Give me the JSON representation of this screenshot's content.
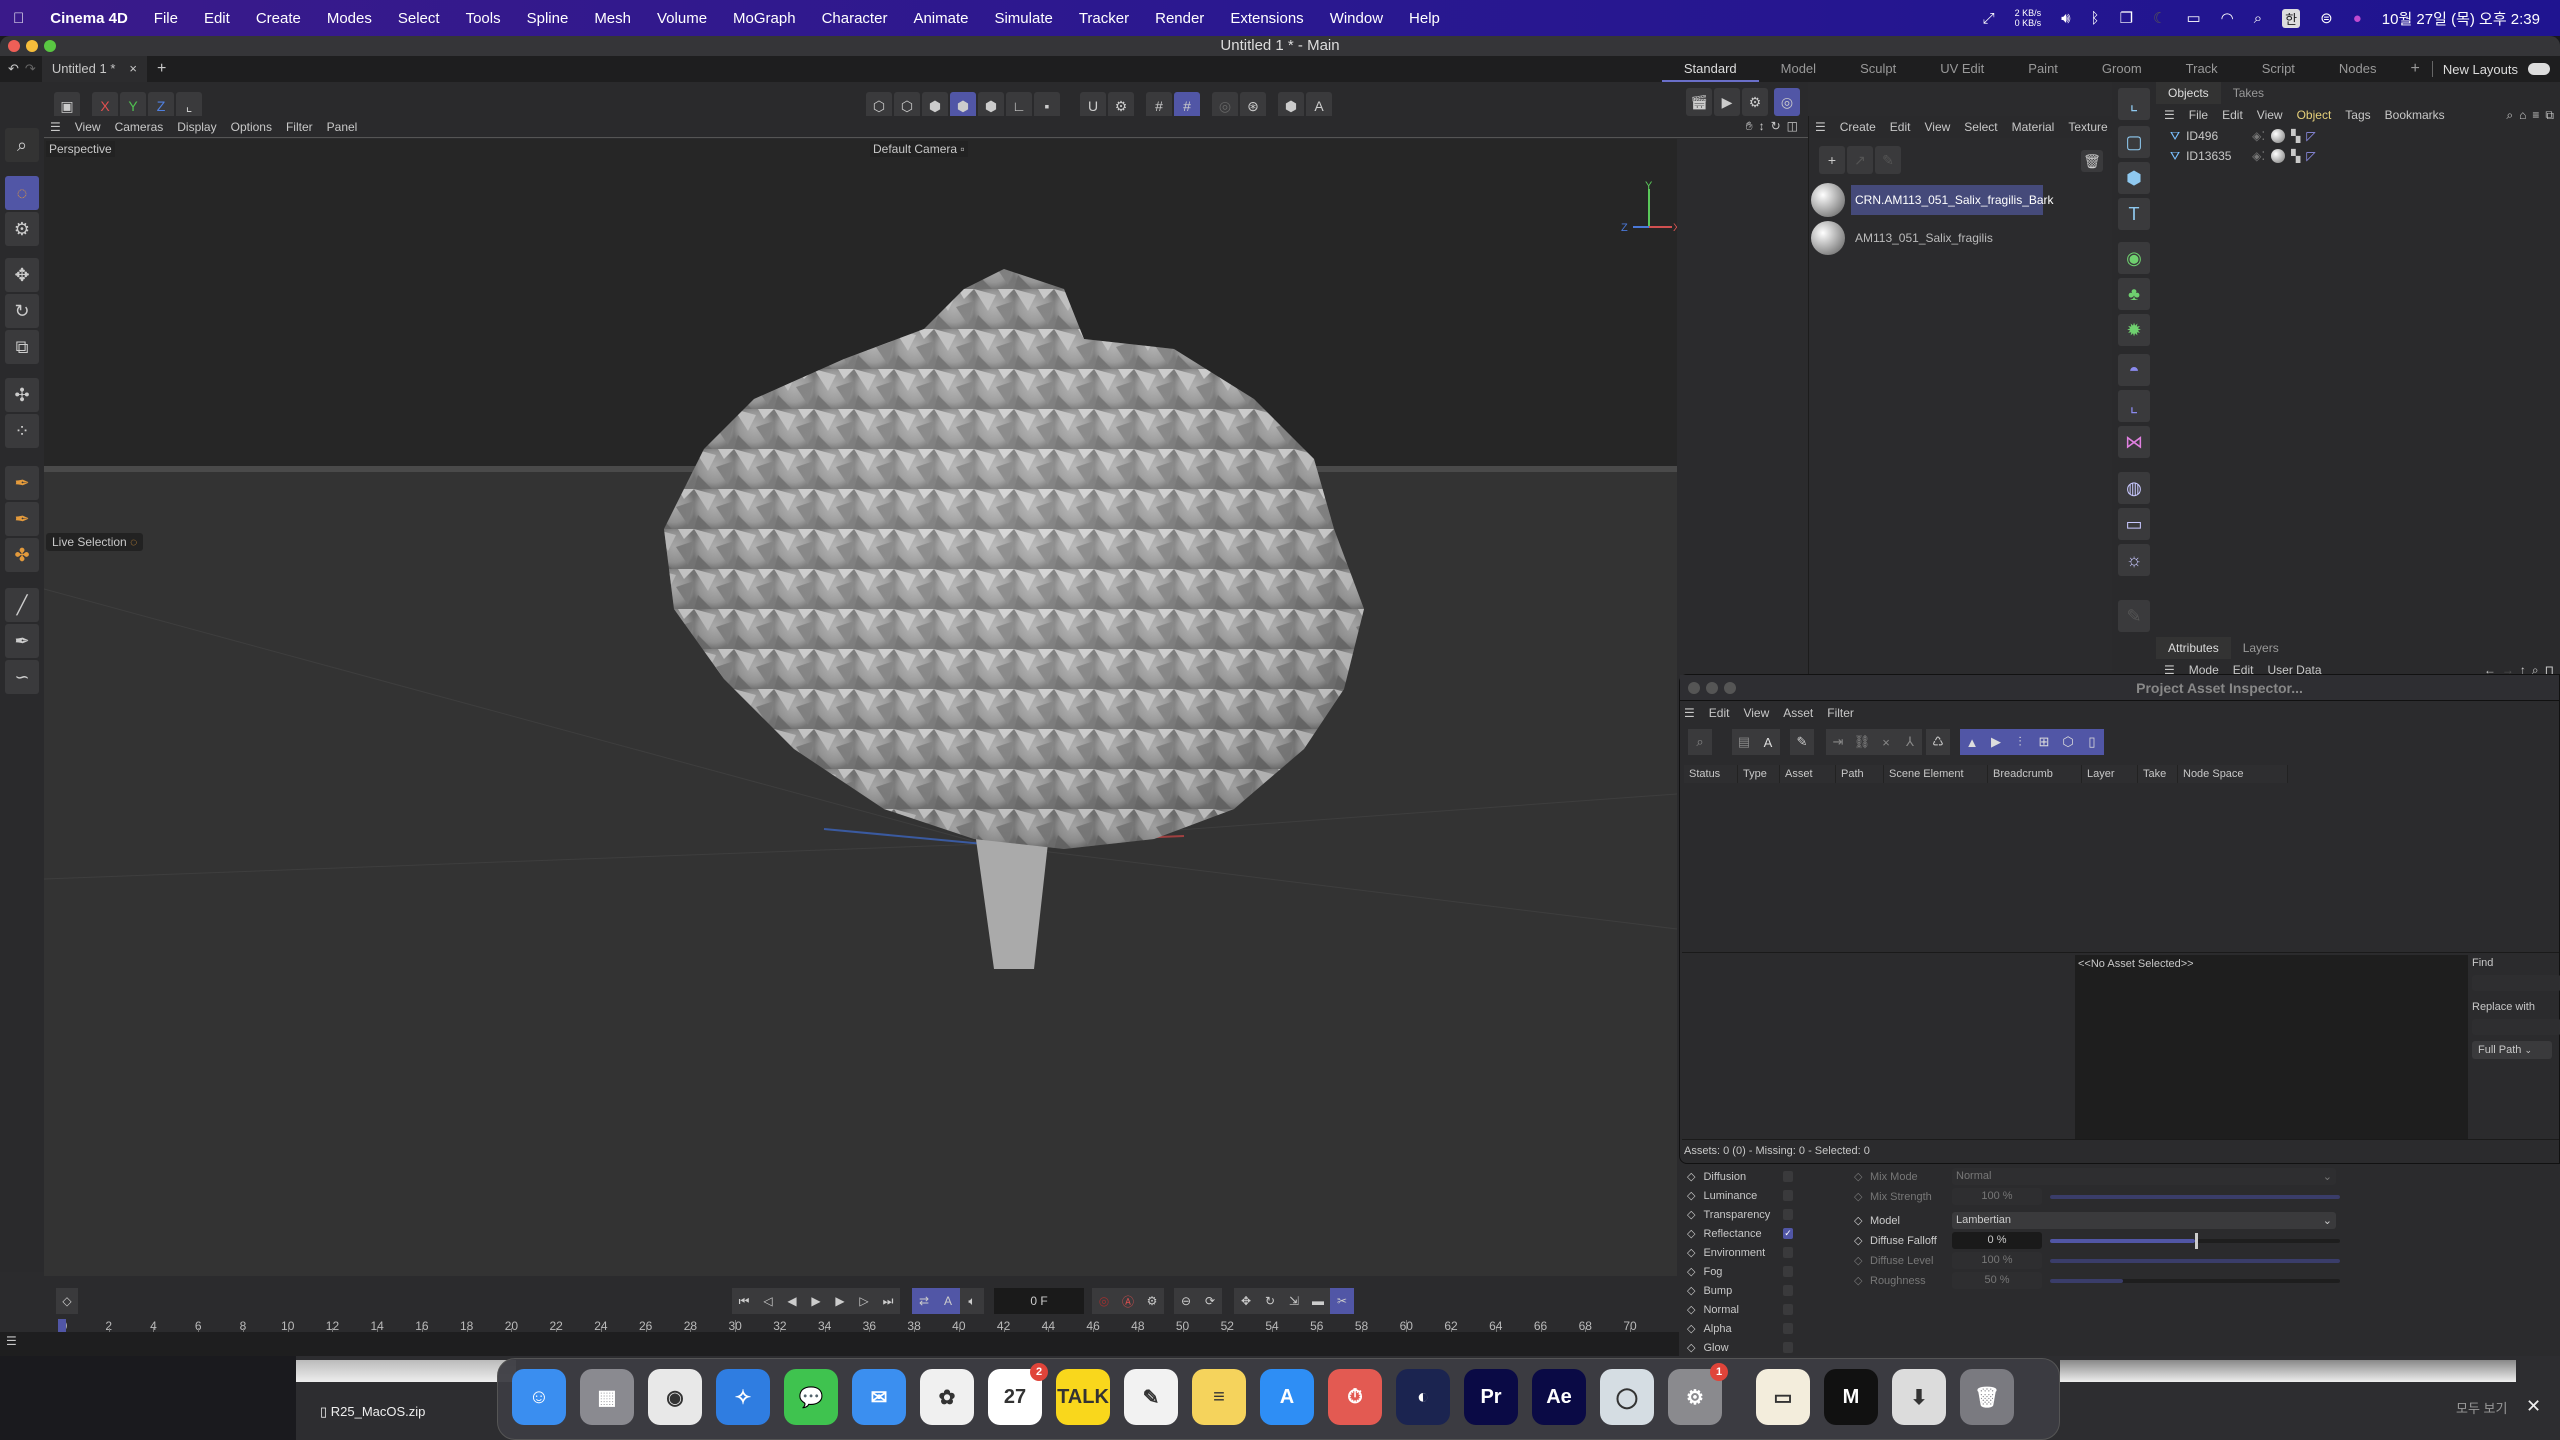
{
  "menubar": {
    "app": "Cinema 4D",
    "items": [
      "File",
      "Edit",
      "Create",
      "Modes",
      "Select",
      "Tools",
      "Spline",
      "Mesh",
      "Volume",
      "MoGraph",
      "Character",
      "Animate",
      "Simulate",
      "Tracker",
      "Render",
      "Extensions",
      "Window",
      "Help"
    ],
    "net_up": "2 KB/s",
    "net_down": "0 KB/s",
    "input_source": "한",
    "datetime": "10월 27일 (목) 오후 2:39"
  },
  "window": {
    "title": "Untitled 1 * - Main",
    "doc_tab": "Untitled 1 *",
    "layouts": [
      "Standard",
      "Model",
      "Sculpt",
      "UV Edit",
      "Paint",
      "Groom",
      "Track",
      "Script",
      "Nodes"
    ],
    "active_layout": "Standard",
    "new_layouts": "New Layouts"
  },
  "toolbar": {
    "axes": [
      "X",
      "Y",
      "Z"
    ]
  },
  "viewport": {
    "menu": [
      "View",
      "Cameras",
      "Display",
      "Options",
      "Filter",
      "Panel"
    ],
    "projection": "Perspective",
    "camera": "Default Camera",
    "tool_label": "Live Selection",
    "axis_labels": {
      "x": "X",
      "y": "Y",
      "z": "Z"
    }
  },
  "timeline": {
    "ruler": [
      "0",
      "2",
      "4",
      "6",
      "8",
      "10",
      "12",
      "14",
      "16",
      "18",
      "20",
      "22",
      "24",
      "26",
      "28",
      "30",
      "32",
      "34",
      "36",
      "38",
      "40",
      "42",
      "44",
      "46",
      "48",
      "50",
      "52",
      "54",
      "56",
      "58",
      "60",
      "62",
      "64",
      "66",
      "68",
      "70"
    ],
    "current_frame": "0 F",
    "start_frame": "0 F",
    "range_label": "0 F"
  },
  "material_manager": {
    "menu": [
      "Create",
      "Edit",
      "View",
      "Select",
      "Material",
      "Texture"
    ],
    "materials": [
      {
        "name": "CRN.AM113_051_Salix_fragilis_Bark",
        "selected": true
      },
      {
        "name": "AM113_051_Salix_fragilis",
        "selected": false
      }
    ]
  },
  "objects_panel": {
    "tabs": [
      "Objects",
      "Takes"
    ],
    "menu": [
      "File",
      "Edit",
      "View",
      "Object",
      "Tags",
      "Bookmarks"
    ],
    "active_menu": "Object",
    "objects": [
      {
        "name": "ID496"
      },
      {
        "name": "ID13635"
      }
    ]
  },
  "attributes_panel": {
    "tabs": [
      "Attributes",
      "Layers"
    ],
    "menu": [
      "Mode",
      "Edit",
      "User Data"
    ]
  },
  "asset_inspector": {
    "title": "Project Asset Inspector...",
    "menu": [
      "Edit",
      "View",
      "Asset",
      "Filter"
    ],
    "columns": [
      "Status",
      "Type",
      "Asset",
      "Path",
      "Scene Element",
      "Breadcrumb",
      "Layer",
      "Take",
      "Node Space"
    ],
    "no_selection": "<<No Asset Selected>>",
    "find_label": "Find",
    "find_value": "",
    "replace_label": "Replace with",
    "replace_value": "",
    "path_mode": "Full Path",
    "status": "Assets: 0 (0) - Missing: 0 - Selected: 0"
  },
  "material_channels": [
    {
      "name": "Diffusion",
      "checked": false
    },
    {
      "name": "Luminance",
      "checked": false
    },
    {
      "name": "Transparency",
      "checked": false
    },
    {
      "name": "Reflectance",
      "checked": true
    },
    {
      "name": "Environment",
      "checked": false
    },
    {
      "name": "Fog",
      "checked": false
    },
    {
      "name": "Bump",
      "checked": false
    },
    {
      "name": "Normal",
      "checked": false
    },
    {
      "name": "Alpha",
      "checked": false
    },
    {
      "name": "Glow",
      "checked": false
    }
  ],
  "material_props": [
    {
      "label": "Mix Mode",
      "value": "Normal",
      "type": "select",
      "enabled": false
    },
    {
      "label": "Mix Strength",
      "value": "100 %",
      "slider": 1.0,
      "enabled": false
    },
    {
      "label": "Model",
      "value": "Lambertian",
      "type": "select",
      "enabled": true
    },
    {
      "label": "Diffuse Falloff",
      "value": "0 %",
      "slider": 0.5,
      "enabled": true
    },
    {
      "label": "Diffuse Level",
      "value": "100 %",
      "slider": 1.0,
      "enabled": false
    },
    {
      "label": "Roughness",
      "value": "50 %",
      "slider": 0.25,
      "enabled": false
    }
  ],
  "downloads": {
    "file": "R25_MacOS.zip",
    "show_all": "모두 보기"
  },
  "dock": [
    {
      "name": "Finder",
      "color": "#3a8ef0",
      "glyph": "☺"
    },
    {
      "name": "Launchpad",
      "color": "#8a8a90",
      "glyph": "▦"
    },
    {
      "name": "Chrome",
      "color": "#e8e8e8",
      "glyph": "◉"
    },
    {
      "name": "Safari",
      "color": "#2f7de1",
      "glyph": "✧"
    },
    {
      "name": "Messages",
      "color": "#3fc34f",
      "glyph": "💬"
    },
    {
      "name": "Mail",
      "color": "#3b8ff0",
      "glyph": "✉"
    },
    {
      "name": "Photos",
      "color": "#f0f0f0",
      "glyph": "✿"
    },
    {
      "name": "Calendar",
      "color": "#ffffff",
      "glyph": "27",
      "badge": "2"
    },
    {
      "name": "KakaoTalk",
      "color": "#f9d71c",
      "glyph": "TALK"
    },
    {
      "name": "TextEdit",
      "color": "#f2f2f2",
      "glyph": "✎"
    },
    {
      "name": "Notes",
      "color": "#f5d35c",
      "glyph": "≡"
    },
    {
      "name": "App Store",
      "color": "#2e8ef5",
      "glyph": "A"
    },
    {
      "name": "Timer",
      "color": "#e35a52",
      "glyph": "⏱"
    },
    {
      "name": "Cinema 4D",
      "color": "#1b2450",
      "glyph": "◐"
    },
    {
      "name": "Premiere Pro",
      "color": "#0a0a45",
      "glyph": "Pr"
    },
    {
      "name": "After Effects",
      "color": "#0a0a45",
      "glyph": "Ae"
    },
    {
      "name": "Stopwatch",
      "color": "#d5dde3",
      "glyph": "◯"
    },
    {
      "name": "System Preferences",
      "color": "#8a8a8e",
      "glyph": "⚙",
      "badge": "1"
    },
    {
      "name": "Archive",
      "color": "#f3eddc",
      "glyph": "▭"
    },
    {
      "name": "Maxon App",
      "color": "#111",
      "glyph": "M"
    },
    {
      "name": "Installer",
      "color": "#dcdcdc",
      "glyph": "⬇"
    },
    {
      "name": "Trash",
      "color": "#7a7a80",
      "glyph": "🗑"
    }
  ]
}
